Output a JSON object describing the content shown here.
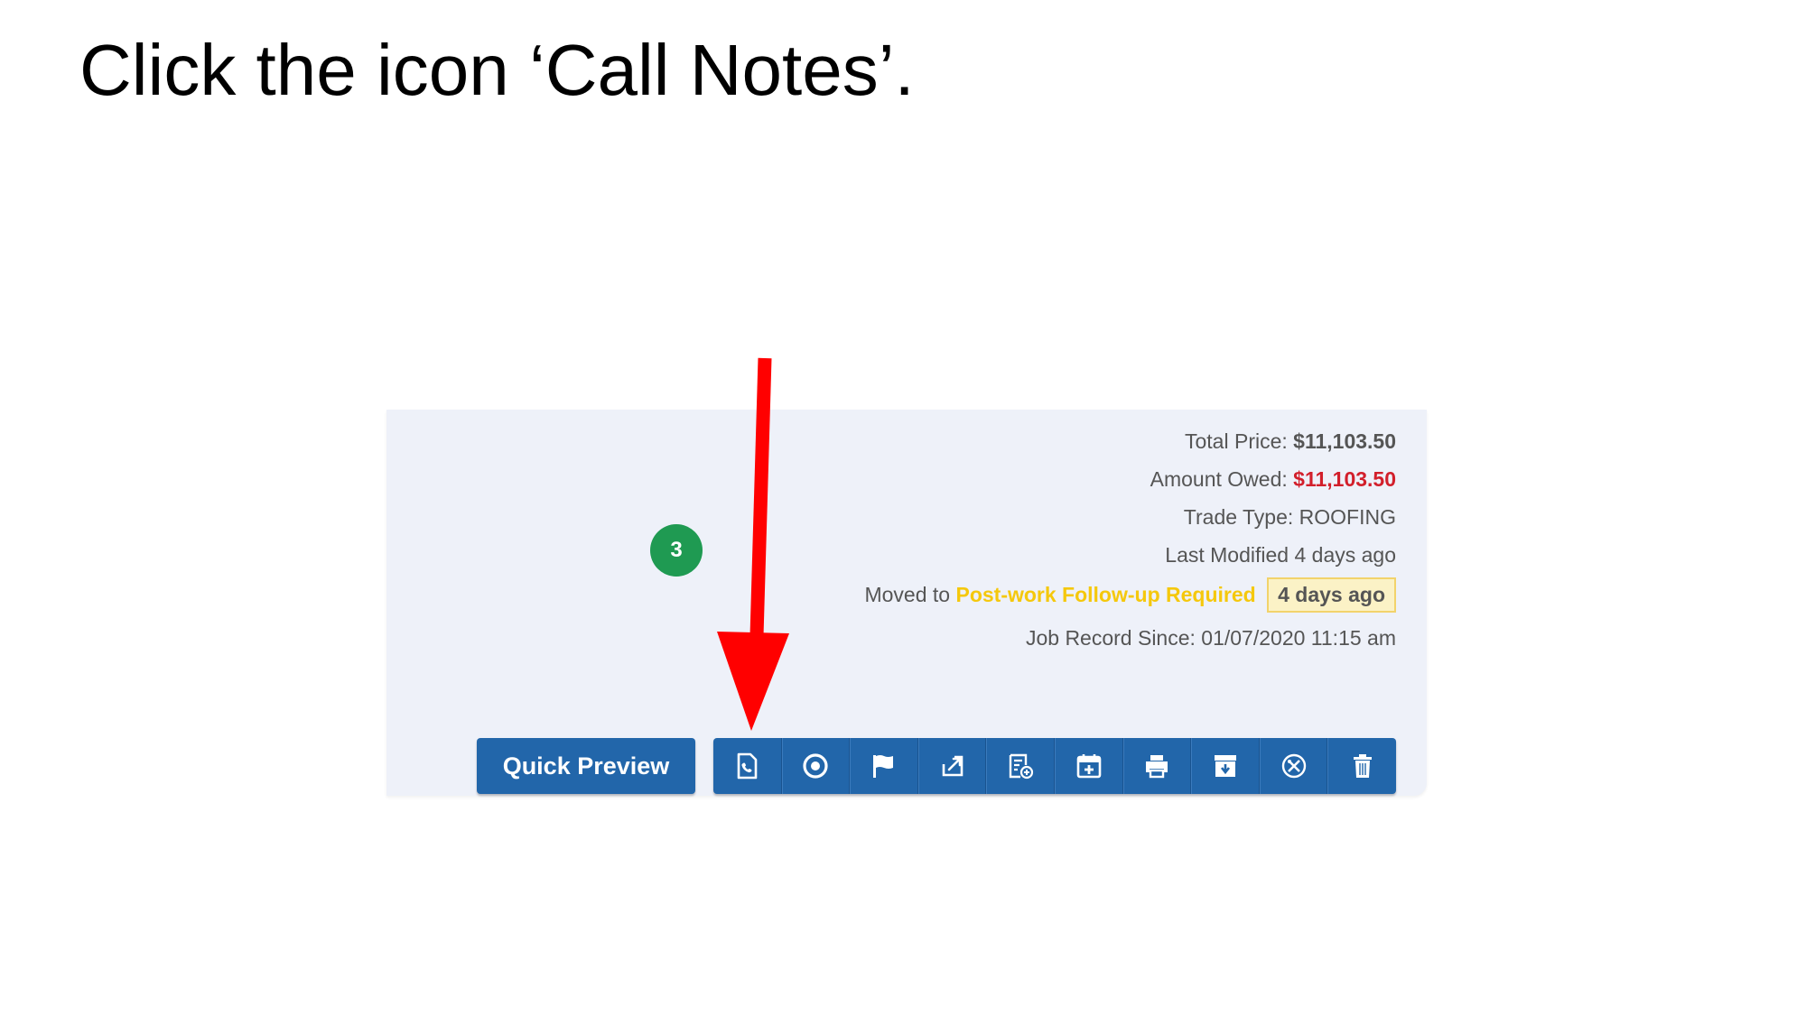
{
  "instruction": "Click the icon ‘Call Notes’.",
  "job_card": {
    "total_price_label": "Total Price:",
    "total_price_value": "$11,103.50",
    "amount_owed_label": "Amount Owed:",
    "amount_owed_value": "$11,103.50",
    "trade_type_label": "Trade Type:",
    "trade_type_value": "ROOFING",
    "last_modified": "Last Modified 4 days ago",
    "moved_to_label": "Moved to",
    "moved_to_status": "Post-work Follow-up Required",
    "moved_to_time": "4 days ago",
    "record_since_label": "Job Record Since:",
    "record_since_value": "01/07/2020 11:15 am",
    "badge_count": "3",
    "quick_preview_label": "Quick Preview"
  },
  "toolbar_icons": [
    "call-notes-icon",
    "target-icon",
    "flag-icon",
    "external-link-icon",
    "add-estimate-icon",
    "calendar-add-icon",
    "print-icon",
    "archive-icon",
    "tools-icon",
    "trash-icon"
  ],
  "colors": {
    "primary_button": "#2266aa",
    "badge_green": "#1f9a52",
    "amount_red": "#d21f2b",
    "status_yellow": "#f5c80c",
    "arrow_red": "#ff0000",
    "card_background": "#eef1f9"
  }
}
